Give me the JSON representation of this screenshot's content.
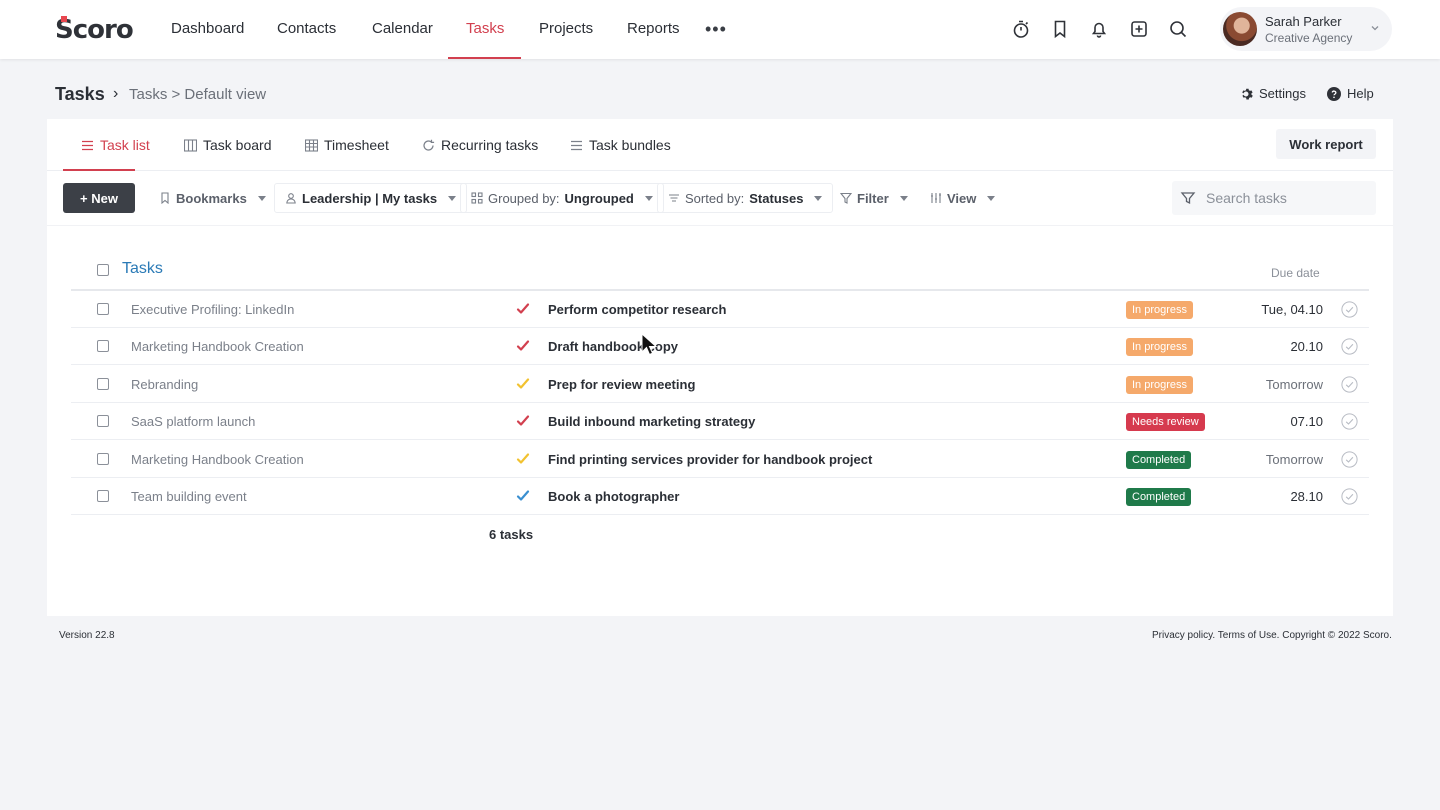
{
  "nav": {
    "logo": "Scoro",
    "items": [
      "Dashboard",
      "Contacts",
      "Calendar",
      "Tasks",
      "Projects",
      "Reports"
    ],
    "active": "Tasks",
    "more": "•••",
    "icons": [
      "timer-icon",
      "bookmark-icon",
      "bell-icon",
      "add-icon",
      "search-icon"
    ]
  },
  "user": {
    "name": "Sarah Parker",
    "org": "Creative Agency"
  },
  "breadcrumb": {
    "title": "Tasks",
    "sep": "›",
    "view": "Tasks > Default view"
  },
  "top_links": {
    "settings": "Settings",
    "help": "Help"
  },
  "tabs": [
    "Task list",
    "Task board",
    "Timesheet",
    "Recurring tasks",
    "Task bundles"
  ],
  "active_tab": "Task list",
  "work_report": "Work report",
  "toolbar": {
    "new": "+ New",
    "bookmarks": "Bookmarks",
    "filter_preset": "Leadership | My tasks",
    "grouped_label": "Grouped by:",
    "grouped_value": "Ungrouped",
    "sorted_label": "Sorted by:",
    "sorted_value": "Statuses",
    "filter": "Filter",
    "view": "View",
    "search_placeholder": "Search tasks"
  },
  "table": {
    "title": "Tasks",
    "due_header": "Due date",
    "rows": [
      {
        "project": "Executive Profiling: LinkedIn",
        "task": "Perform competitor research",
        "priority_color": "#d2404f",
        "status": "In progress",
        "status_color": "#f5a96b",
        "due": "Tue, 04.10"
      },
      {
        "project": "Marketing Handbook Creation",
        "task": "Draft handbook copy",
        "priority_color": "#d2404f",
        "status": "In progress",
        "status_color": "#f5a96b",
        "due": "20.10"
      },
      {
        "project": "Rebranding",
        "task": "Prep for review meeting",
        "priority_color": "#f2c230",
        "status": "In progress",
        "status_color": "#f5a96b",
        "due": "Tomorrow"
      },
      {
        "project": "SaaS platform launch",
        "task": "Build inbound marketing strategy",
        "priority_color": "#d2404f",
        "status": "Needs review",
        "status_color": "#d63a4e",
        "due": "07.10"
      },
      {
        "project": "Marketing Handbook Creation",
        "task": "Find printing services provider for handbook project",
        "priority_color": "#f2c230",
        "status": "Completed",
        "status_color": "#1f7a4a",
        "due": "Tomorrow"
      },
      {
        "project": "Team building event",
        "task": "Book a photographer",
        "priority_color": "#3a8fd0",
        "status": "Completed",
        "status_color": "#1f7a4a",
        "due": "28.10"
      }
    ],
    "count": "6 tasks"
  },
  "footer": {
    "version": "Version 22.8",
    "legal": "Privacy policy. Terms of Use. Copyright © 2022 Scoro."
  }
}
